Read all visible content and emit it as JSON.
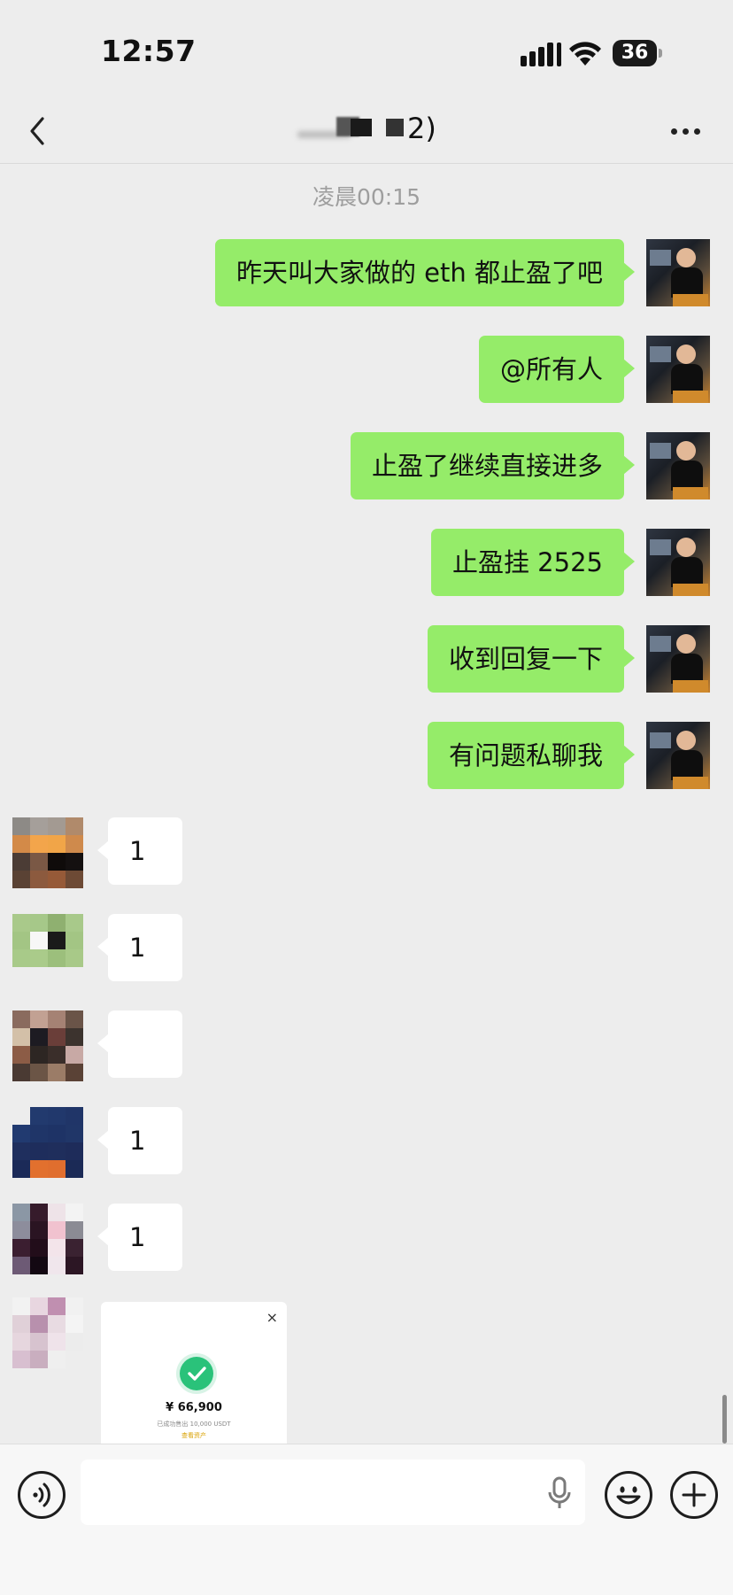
{
  "status_bar": {
    "time": "12:57",
    "battery": "36"
  },
  "nav": {
    "title_visible": "2)"
  },
  "timestamp": "凌晨00:15",
  "messages_out": [
    {
      "text": "昨天叫大家做的 eth 都止盈了吧"
    },
    {
      "text": "@所有人"
    },
    {
      "text": "止盈了继续直接进多"
    },
    {
      "text": "止盈挂 2525"
    },
    {
      "text": "收到回复一下"
    },
    {
      "text": "有问题私聊我"
    }
  ],
  "messages_in": [
    {
      "text": "1"
    },
    {
      "text": "1"
    },
    {
      "text": ""
    },
    {
      "text": "1"
    },
    {
      "text": "1"
    }
  ],
  "card": {
    "close": "×",
    "amount": "¥ 66,900",
    "subtitle": "已成功售出 10,000 USDT",
    "link": "查看资产"
  },
  "icons": [
    "back-icon",
    "more-icon",
    "voice-icon",
    "mic-icon",
    "emoji-icon",
    "plus-icon",
    "check-icon"
  ],
  "colors": {
    "outgoing_bubble": "#95ec69",
    "incoming_bubble": "#ffffff",
    "background": "#ededed"
  }
}
